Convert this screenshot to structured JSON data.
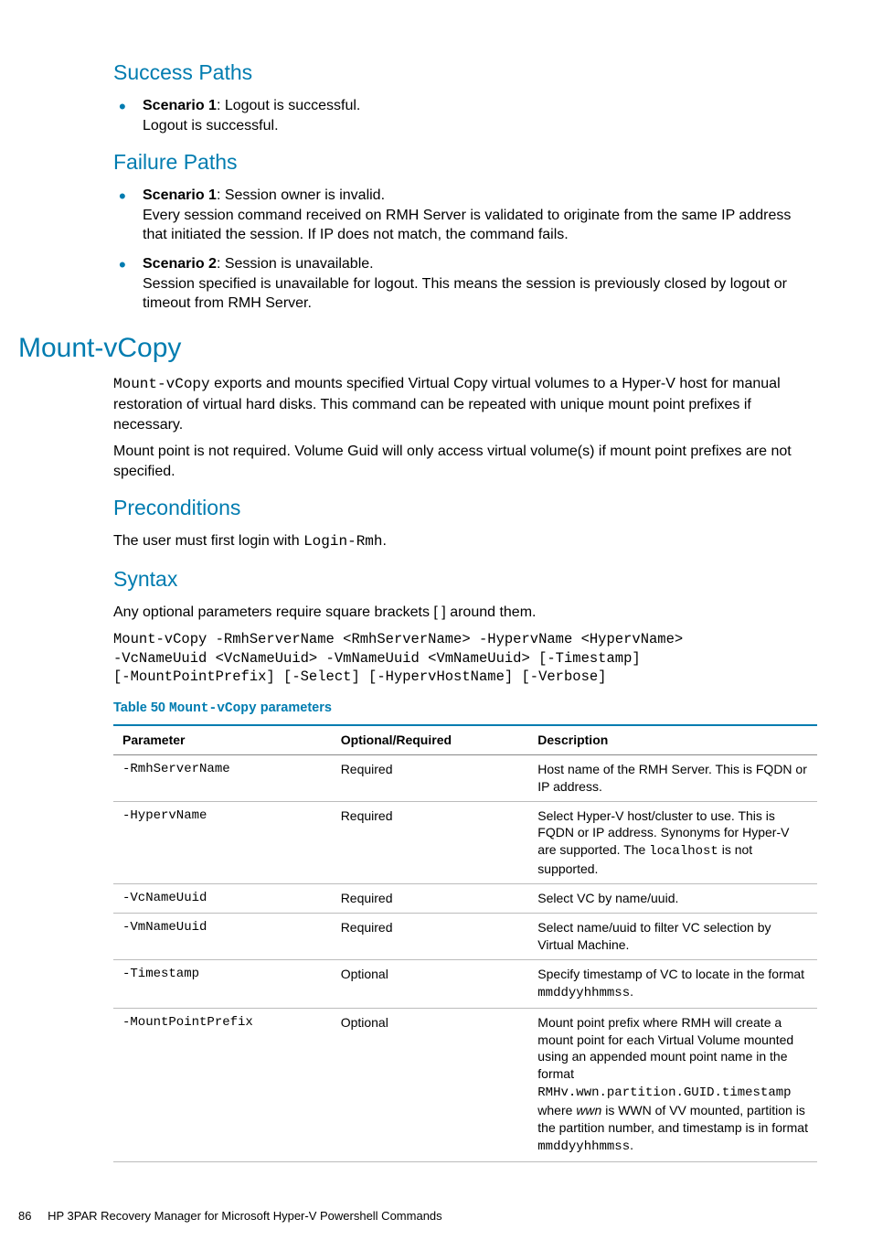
{
  "sections": {
    "success": {
      "title": "Success Paths",
      "items": [
        {
          "label": "Scenario 1",
          "summary": ": Logout is successful.",
          "detail": "Logout is successful."
        }
      ]
    },
    "failure": {
      "title": "Failure Paths",
      "items": [
        {
          "label": "Scenario 1",
          "summary": ": Session owner is invalid.",
          "detail": "Every session command received on RMH Server is validated to originate from the same IP address that initiated the session. If IP does not match, the command fails."
        },
        {
          "label": "Scenario 2",
          "summary": ": Session is unavailable.",
          "detail": "Session specified is unavailable for logout. This means the session is previously closed by logout or timeout from RMH Server."
        }
      ]
    }
  },
  "mount": {
    "title": "Mount-vCopy",
    "cmd": "Mount-vCopy",
    "intro_after": " exports and mounts specified Virtual Copy virtual volumes to a Hyper-V host for manual restoration of virtual hard disks. This command can be repeated with unique mount point prefixes if necessary.",
    "intro2": "Mount point is not required. Volume Guid will only access virtual volume(s) if mount point prefixes are not specified."
  },
  "preconditions": {
    "title": "Preconditions",
    "text_before": "The user must first login with ",
    "cmd": "Login-Rmh",
    "text_after": "."
  },
  "syntax": {
    "title": "Syntax",
    "note": "Any optional parameters require square brackets [ ] around them.",
    "code": "Mount-vCopy -RmhServerName <RmhServerName> -HypervName <HypervName>\n-VcNameUuid <VcNameUuid> -VmNameUuid <VmNameUuid> [-Timestamp]\n[-MountPointPrefix] [-Select] [-HypervHostName] [-Verbose]"
  },
  "table": {
    "caption_label": "Table 50 ",
    "caption_cmd": "Mount-vCopy",
    "caption_title": " parameters",
    "headers": {
      "c1": "Parameter",
      "c2": "Optional/Required",
      "c3": "Description"
    },
    "rows": [
      {
        "param": "-RmhServerName",
        "req": "Required",
        "desc": [
          {
            "t": "Host name of the RMH Server. This is FQDN or IP address."
          }
        ]
      },
      {
        "param": "-HypervName",
        "req": "Required",
        "desc": [
          {
            "t": "Select Hyper-V host/cluster to use. This is FQDN or IP address. Synonyms for Hyper-V are supported. The "
          },
          {
            "t": "localhost",
            "mono": true
          },
          {
            "t": " is not supported."
          }
        ]
      },
      {
        "param": "-VcNameUuid",
        "req": "Required",
        "desc": [
          {
            "t": "Select VC by name/uuid."
          }
        ]
      },
      {
        "param": "-VmNameUuid",
        "req": "Required",
        "desc": [
          {
            "t": "Select name/uuid to filter VC selection by Virtual Machine."
          }
        ]
      },
      {
        "param": "-Timestamp",
        "req": "Optional",
        "desc": [
          {
            "t": "Specify timestamp of VC to locate in the format "
          },
          {
            "t": "mmddyyhhmmss",
            "mono": true
          },
          {
            "t": "."
          }
        ]
      },
      {
        "param": "-MountPointPrefix",
        "req": "Optional",
        "desc": [
          {
            "t": "Mount point prefix where RMH will create a mount point for each Virtual Volume mounted using an appended mount point name in the format "
          },
          {
            "t": "RMHv.wwn.partition.GUID.timestamp",
            "mono": true
          },
          {
            "t": " where "
          },
          {
            "t": "wwn",
            "italic": true
          },
          {
            "t": " is WWN of VV mounted, partition is the partition number, and timestamp is in format "
          },
          {
            "t": "mmddyyhhmmss",
            "mono": true
          },
          {
            "t": "."
          }
        ]
      }
    ]
  },
  "footer": {
    "page": "86",
    "title": "HP 3PAR Recovery Manager for Microsoft Hyper-V Powershell Commands"
  }
}
